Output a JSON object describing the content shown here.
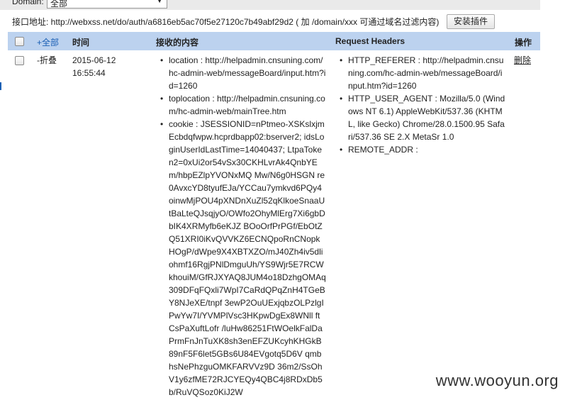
{
  "filter": {
    "domain_label": "Domain:",
    "domain_value": "全部"
  },
  "api": {
    "label_text": "接口地址: http://webxss.net/do/auth/a6816eb5ac70f5e27120c7b49abf29d2 ( 加 /domain/xxx 可通过域名过滤内容)",
    "install_label": "安装插件"
  },
  "table": {
    "headers": {
      "all": "+全部",
      "time": "时间",
      "content": "接收的内容",
      "req_headers": "Request Headers",
      "actions": "操作"
    },
    "row": {
      "toggle": "-折叠",
      "date": "2015-06-12",
      "time": "16:55:44",
      "content": [
        "location : http://helpadmin.cnsuning.com/hc-admin-web/messageBoard/input.htm?id=1260",
        "toplocation : http://helpadmin.cnsuning.com/hc-admin-web/mainTree.htm",
        "cookie : JSESSIONID=nPtmeo-XSKslxjmEcbdqfwpw.hcprdbapp02:bserver2; idsLoginUserIdLastTime=14040437; LtpaToken2=0xUi2or54vSx30CKHLvrAk4QnbYEm/hbpEZlpYVONxMQ Mw/N6g0HSGN re0AvxcYD8tyufEJa/YCCau7ymkvd6PQy4oinwMjPOU4pXNDnXuZl52qKlkoeSnaaUtBaLteQJsqjyO/OWfo2OhyMlErg7Xi6gbDbIK4XRMyfb6eKJZ BOoOrfPrPGf/EbOtZQ51XRI0iKvQVVKZ6ECNQpoRnCNopkHOgP/dWpe9X4XBTXZO/mJ40Zh4iv5dliohmf16RgjPNlDmguUh/YS9Wjr5E7RCWkhouiM/GfRJXYAQ8JUM4o18DzhgOMAq309DFqFQxli7WpI7CaRdQPqZnH4TGeBY8NJeXE/tnpf 3ewP2OuUExjqbzOLPzlgIPwYw7I/YVMPlVsc3HKpwDgEx8WNll ftCsPaXuftLofr /luHw86251FtWOelkFalDaPrmFnJnTuXK8sh3enEFZUKcyhKHGkB89nF5F6let5GBs6U84EVgotq5D6V qmbhsNePhzguOMKFARVVz9D 36m2/SsOhV1y6zfME72RJCYEQy4QBC4j8RDxDb5b/RuVQSoz0KiJ2W"
      ],
      "headers": [
        "HTTP_REFERER : http://helpadmin.cnsuning.com/hc-admin-web/messageBoard/input.htm?id=1260",
        "HTTP_USER_AGENT : Mozilla/5.0 (Windows NT 6.1) AppleWebKit/537.36 (KHTML, like Gecko) Chrome/28.0.1500.95 Safari/537.36 SE 2.X MetaSr 1.0",
        "REMOTE_ADDR :"
      ],
      "delete_label": "删除"
    }
  },
  "watermark": "www.wooyun.org"
}
